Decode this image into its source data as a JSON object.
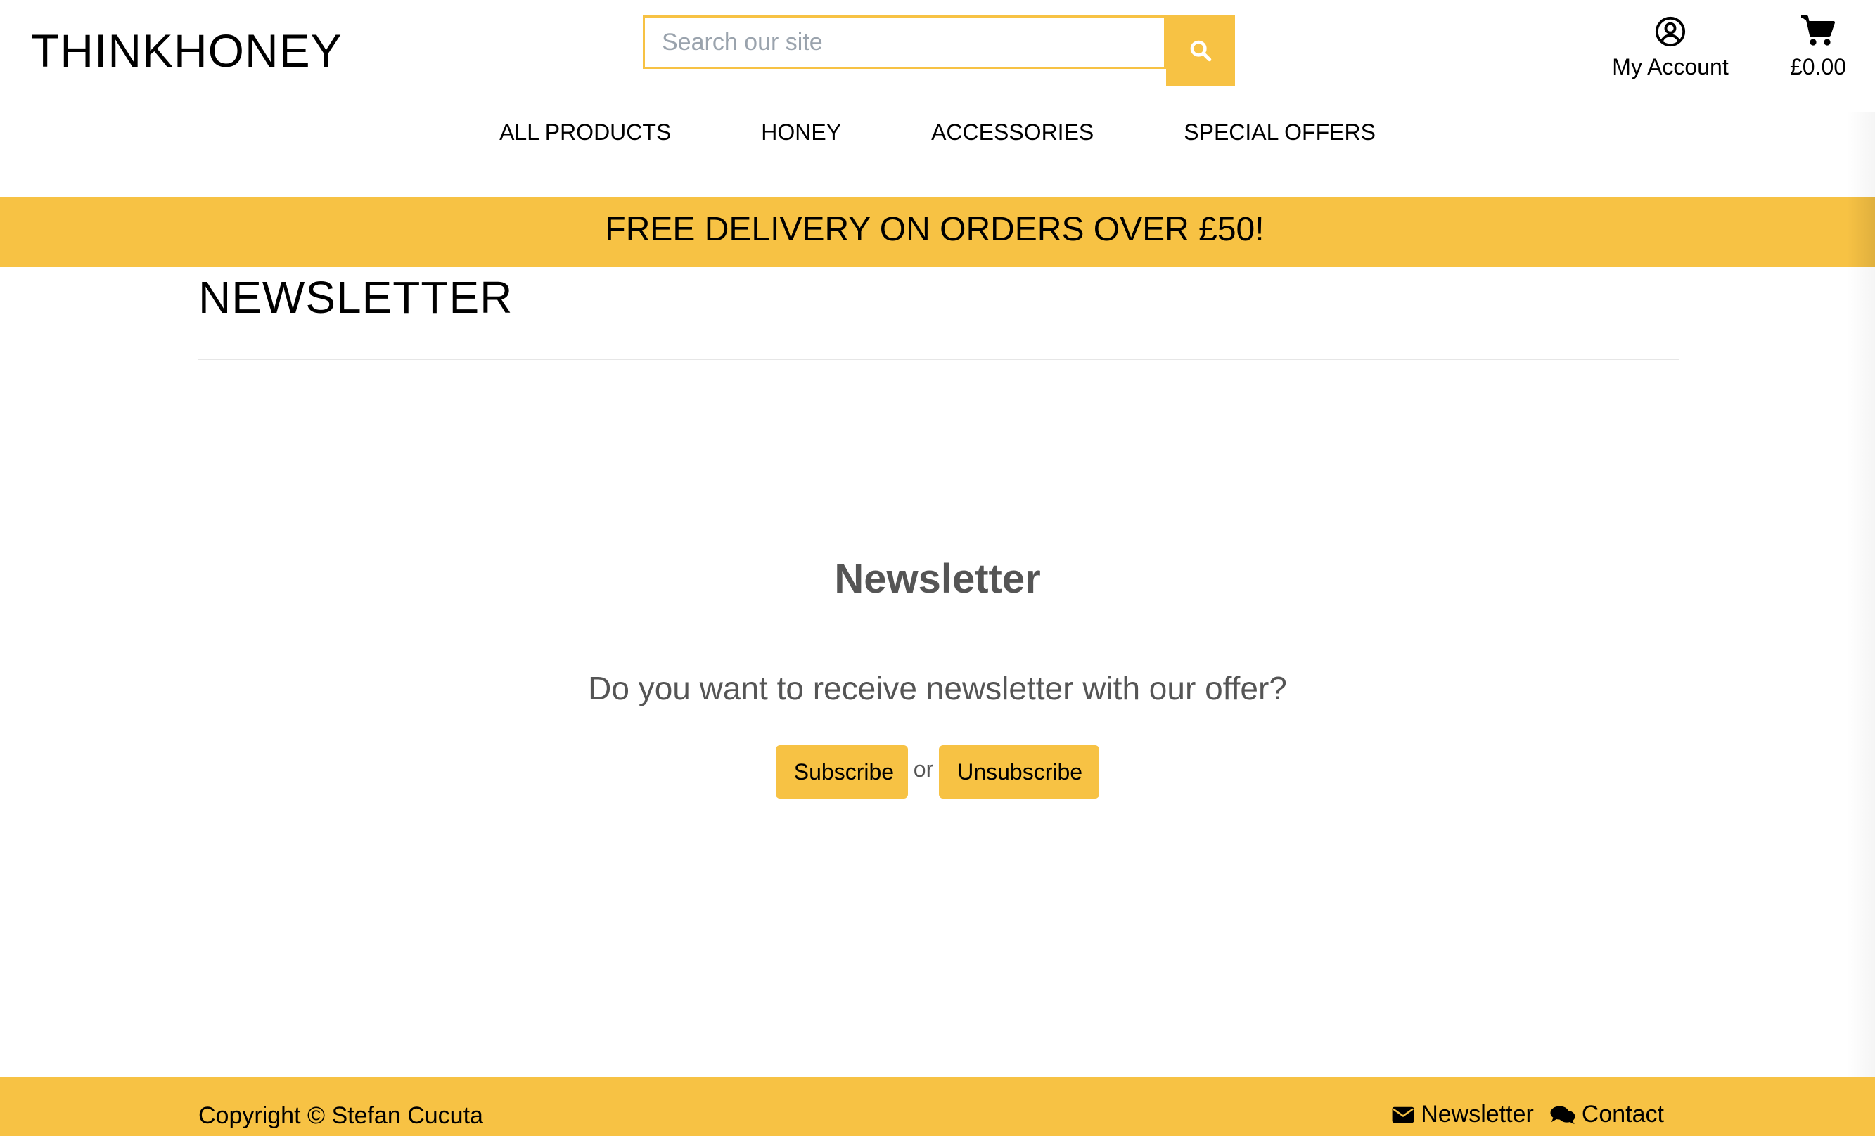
{
  "header": {
    "logo": "THINKHONEY",
    "search": {
      "placeholder": "Search our site",
      "value": ""
    },
    "account_label": "My Account",
    "cart_total": "£0.00",
    "icons": {
      "search": "search-icon",
      "account": "user-circle-icon",
      "cart": "shopping-cart-icon"
    }
  },
  "nav": {
    "items": [
      {
        "label": "ALL PRODUCTS"
      },
      {
        "label": "HONEY"
      },
      {
        "label": "ACCESSORIES"
      },
      {
        "label": "SPECIAL OFFERS"
      }
    ]
  },
  "banner": {
    "text": "FREE DELIVERY ON ORDERS OVER £50!"
  },
  "main": {
    "page_title": "NEWSLETTER",
    "section_heading": "Newsletter",
    "prompt": "Do you want to receive newsletter with our offer?",
    "subscribe_label": "Subscribe",
    "or_text": "or",
    "unsubscribe_label": "Unsubscribe"
  },
  "footer": {
    "copyright": "Copyright © Stefan Cucuta",
    "links": [
      {
        "label": "Newsletter",
        "icon": "envelope-icon"
      },
      {
        "label": "Contact",
        "icon": "comments-icon"
      }
    ]
  },
  "colors": {
    "accent": "#f7c244",
    "heading_gray": "#555555",
    "placeholder_gray": "#9aa3ad"
  }
}
